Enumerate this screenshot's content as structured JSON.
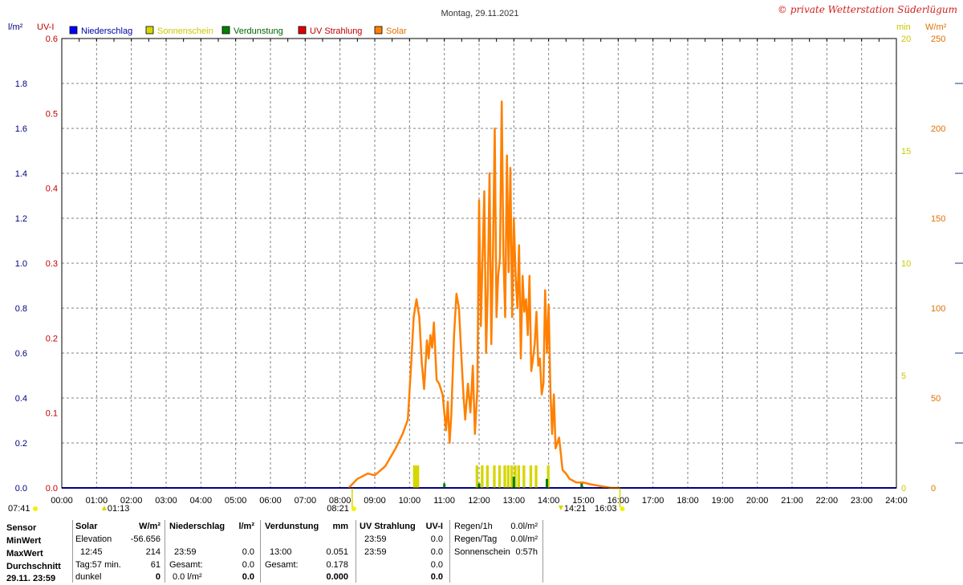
{
  "header": {
    "title": "Montag, 29.11.2021",
    "copyright": "© private Wetterstation Süderlügum"
  },
  "legend": [
    {
      "label": "Niederschlag",
      "color": "#0000ff",
      "text_color": "#0000a0"
    },
    {
      "label": "Sonnenschein",
      "color": "#d6d600",
      "text_color": "#c8c800"
    },
    {
      "label": "Verdunstung",
      "color": "#008000",
      "text_color": "#006400"
    },
    {
      "label": "UV Strahlung",
      "color": "#e00000",
      "text_color": "#c00000"
    },
    {
      "label": "Solar",
      "color": "#ff8000",
      "text_color": "#e07000"
    }
  ],
  "colors": {
    "solar": "#ff8000",
    "sunshine": "#d6d600",
    "evaporation": "#008000",
    "rain": "#0000ff",
    "uv": "#e00000",
    "grid": "#808080",
    "axis_rain": "#000080",
    "axis_uv": "#c00000",
    "axis_min": "#c8c800",
    "axis_solar": "#e07000"
  },
  "chart_data": {
    "type": "line",
    "title": "Montag, 29.11.2021",
    "x_unit": "hour",
    "xlim": [
      0,
      24
    ],
    "x_ticks": [
      "00:00",
      "01:00",
      "02:00",
      "03:00",
      "04:00",
      "05:00",
      "06:00",
      "07:00",
      "08:00",
      "09:00",
      "10:00",
      "11:00",
      "12:00",
      "13:00",
      "14:00",
      "15:00",
      "16:00",
      "17:00",
      "18:00",
      "19:00",
      "20:00",
      "21:00",
      "22:00",
      "23:00",
      "24:00"
    ],
    "grid": true,
    "axes": {
      "rain": {
        "unit": "l/m²",
        "range": [
          0,
          2.0
        ],
        "ticks": [
          "0.0",
          "0.2",
          "0.4",
          "0.6",
          "0.8",
          "1.0",
          "1.2",
          "1.4",
          "1.6",
          "1.8"
        ]
      },
      "uv": {
        "unit": "UV-I",
        "range": [
          0,
          0.6
        ],
        "ticks": [
          "0.0",
          "0.1",
          "0.2",
          "0.3",
          "0.4",
          "0.5",
          "0.6"
        ]
      },
      "sunshine_min": {
        "unit": "min",
        "range": [
          0,
          20
        ],
        "ticks": [
          "0",
          "5",
          "10",
          "15",
          "20"
        ]
      },
      "solar": {
        "unit": "W/m²",
        "range": [
          0,
          250
        ],
        "ticks": [
          "0",
          "50",
          "100",
          "150",
          "200",
          "250"
        ]
      }
    },
    "series": [
      {
        "name": "Solar",
        "axis": "solar",
        "x": [
          8.25,
          8.5,
          8.8,
          9.0,
          9.3,
          9.6,
          9.8,
          9.95,
          10.05,
          10.12,
          10.2,
          10.28,
          10.35,
          10.42,
          10.5,
          10.55,
          10.6,
          10.65,
          10.7,
          10.78,
          10.85,
          10.95,
          11.05,
          11.1,
          11.15,
          11.2,
          11.28,
          11.35,
          11.42,
          11.5,
          11.55,
          11.6,
          11.68,
          11.75,
          11.82,
          11.88,
          11.95,
          12.0,
          12.05,
          12.1,
          12.15,
          12.2,
          12.25,
          12.3,
          12.35,
          12.4,
          12.45,
          12.5,
          12.55,
          12.6,
          12.65,
          12.7,
          12.75,
          12.8,
          12.85,
          12.9,
          12.95,
          13.0,
          13.05,
          13.1,
          13.15,
          13.2,
          13.25,
          13.3,
          13.35,
          13.4,
          13.45,
          13.5,
          13.55,
          13.6,
          13.65,
          13.7,
          13.75,
          13.8,
          13.85,
          13.9,
          13.95,
          14.0,
          14.05,
          14.1,
          14.15,
          14.2,
          14.3,
          14.4,
          14.5,
          14.6,
          14.7,
          14.8,
          15.0,
          15.2,
          15.5,
          15.8,
          16.0,
          16.05
        ],
        "y": [
          0,
          5,
          8,
          7,
          12,
          22,
          30,
          38,
          70,
          95,
          105,
          95,
          70,
          55,
          82,
          72,
          85,
          78,
          92,
          60,
          58,
          52,
          32,
          48,
          25,
          40,
          85,
          108,
          100,
          70,
          52,
          38,
          58,
          42,
          68,
          30,
          55,
          160,
          90,
          128,
          165,
          75,
          110,
          175,
          80,
          130,
          200,
          95,
          118,
          128,
          215,
          130,
          95,
          185,
          120,
          178,
          95,
          150,
          118,
          100,
          135,
          72,
          118,
          98,
          105,
          85,
          118,
          65,
          72,
          80,
          98,
          68,
          72,
          52,
          58,
          110,
          75,
          102,
          55,
          30,
          52,
          22,
          28,
          10,
          8,
          5,
          4,
          3,
          3,
          2,
          1,
          0,
          0,
          0
        ],
        "color": "#ff8000"
      },
      {
        "name": "Sonnenschein",
        "axis": "sunshine_min",
        "bars": [
          [
            10.1,
            10.3,
            1
          ],
          [
            11.9,
            12.0,
            1
          ],
          [
            12.05,
            12.15,
            1
          ],
          [
            12.2,
            12.3,
            1
          ],
          [
            12.4,
            12.5,
            1
          ],
          [
            12.55,
            12.65,
            1
          ],
          [
            12.7,
            12.8,
            1
          ],
          [
            12.8,
            12.9,
            1
          ],
          [
            12.9,
            13.0,
            1
          ],
          [
            13.0,
            13.1,
            1
          ],
          [
            13.1,
            13.2,
            1
          ],
          [
            13.25,
            13.35,
            1
          ],
          [
            13.45,
            13.55,
            1
          ],
          [
            13.6,
            13.7,
            1
          ],
          [
            13.95,
            14.05,
            1
          ]
        ],
        "color": "#d6d600"
      },
      {
        "name": "Verdunstung",
        "axis": "rain",
        "bars": [
          [
            11.0,
            0.02
          ],
          [
            12.0,
            0.02
          ],
          [
            13.0,
            0.05
          ],
          [
            13.95,
            0.04
          ],
          [
            14.95,
            0.02
          ]
        ],
        "color": "#008000"
      }
    ],
    "markers": {
      "sunrise_label": "08:21",
      "sunset_label": "16:03",
      "sunrise_hour": 8.35,
      "sunset_hour": 16.05,
      "left_label": "07:41",
      "mark1_label": "01:13",
      "mark2_label": "14:21",
      "mark1_hour": 1.22,
      "mark2_hour": 14.35
    }
  },
  "stats": {
    "sensor_col": {
      "title": "Sensor",
      "rows": [
        "MinWert",
        "MaxWert",
        "Durchschnitt",
        "29.11. 23:59"
      ]
    },
    "solar": {
      "title": "Solar",
      "unit": "W/m²",
      "rows": [
        [
          "Elevation",
          "-56.656"
        ],
        [
          "12:45",
          "214"
        ],
        [
          "Tag:57 min.",
          "61"
        ],
        [
          "dunkel",
          "0"
        ]
      ]
    },
    "rain": {
      "title": "Niederschlag",
      "unit": "l/m²",
      "rows": [
        [
          "",
          ""
        ],
        [
          "23:59",
          "0.0"
        ],
        [
          "Gesamt:",
          "0.0"
        ],
        [
          "0.0 l/m²",
          "0.0"
        ]
      ]
    },
    "evap": {
      "title": "Verdunstung",
      "unit": "mm",
      "rows": [
        [
          "",
          ""
        ],
        [
          "13:00",
          "0.051"
        ],
        [
          "Gesamt:",
          "0.178"
        ],
        [
          "",
          "0.000"
        ]
      ]
    },
    "uv": {
      "title": "UV Strahlung",
      "unit": "UV-I",
      "rows": [
        [
          "23:59",
          "0.0"
        ],
        [
          "23:59",
          "0.0"
        ],
        [
          "",
          "0.0"
        ],
        [
          "",
          "0.0"
        ]
      ]
    },
    "extra": {
      "rows": [
        [
          "Regen/1h",
          "0.0l/m²"
        ],
        [
          "Regen/Tag",
          "0.0l/m²"
        ],
        [
          "Sonnenschein",
          "0:57h"
        ]
      ]
    }
  }
}
